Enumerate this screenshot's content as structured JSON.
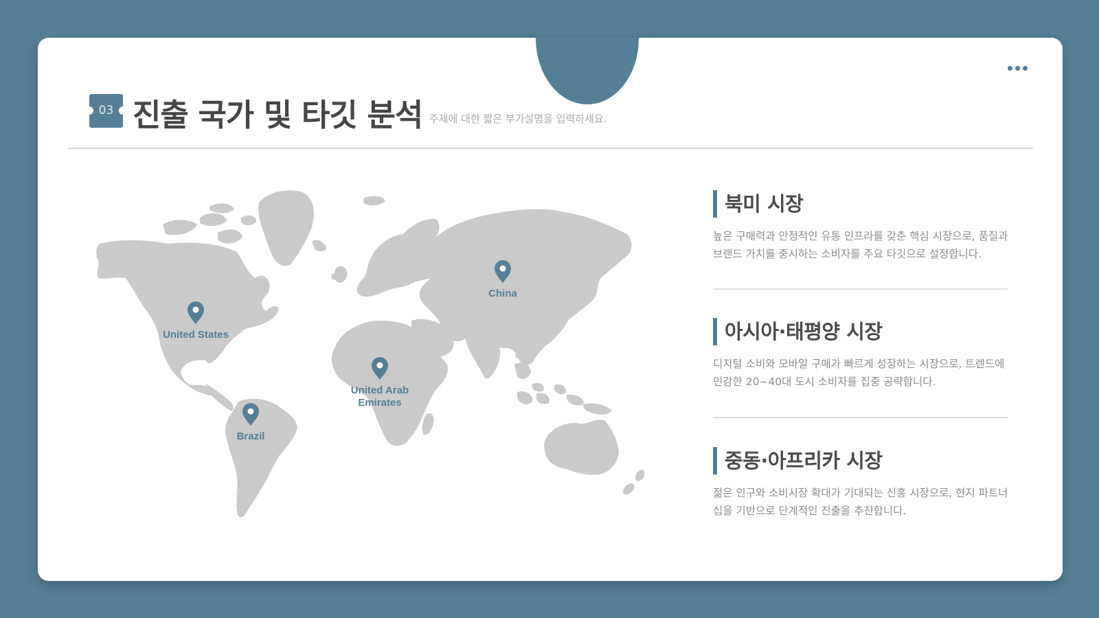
{
  "header": {
    "badge": "03",
    "title": "진출 국가 및 타깃 분석",
    "subtitle": "주제에 대한 짧은 부가설명을 입력하세요."
  },
  "map": {
    "markers": [
      {
        "name": "united-states",
        "label_lines": [
          "United States"
        ]
      },
      {
        "name": "brazil",
        "label_lines": [
          "Brazil"
        ]
      },
      {
        "name": "united-arab-emirates",
        "label_lines": [
          "United Arab",
          "Emirates"
        ]
      },
      {
        "name": "china",
        "label_lines": [
          "China"
        ]
      }
    ],
    "land_color": "#cacaca",
    "marker_color": "#557f97"
  },
  "sections": [
    {
      "title": "북미 시장",
      "body_lines": [
        "높은 구매력과 안정적인 유통 인프라를 갖춘 핵심 시장으로, 품질과",
        "브랜드 가치를 중시하는 소비자를 주요 타깃으로 설정합니다."
      ]
    },
    {
      "title": "아시아·태평양 시장",
      "body_lines": [
        "디지털 소비와 모바일 구매가 빠르게 성장하는 시장으로, 트렌드에",
        "민감한 20~40대 도시 소비자를 집중 공략합니다."
      ]
    },
    {
      "title": "중동·아프리카 시장",
      "body_lines": [
        "젊은 인구와 소비시장 확대가 기대되는 신흥 시장으로, 현지 파트너",
        "십을 기반으로 단계적인 진출을 추진합니다."
      ]
    }
  ],
  "colors": {
    "background": "#557f97",
    "accent": "#557f97",
    "card": "#ffffff",
    "title_text": "#454545",
    "body_text": "#8c8c8c"
  },
  "icons": [
    "more-icon",
    "location-pin-icon"
  ]
}
